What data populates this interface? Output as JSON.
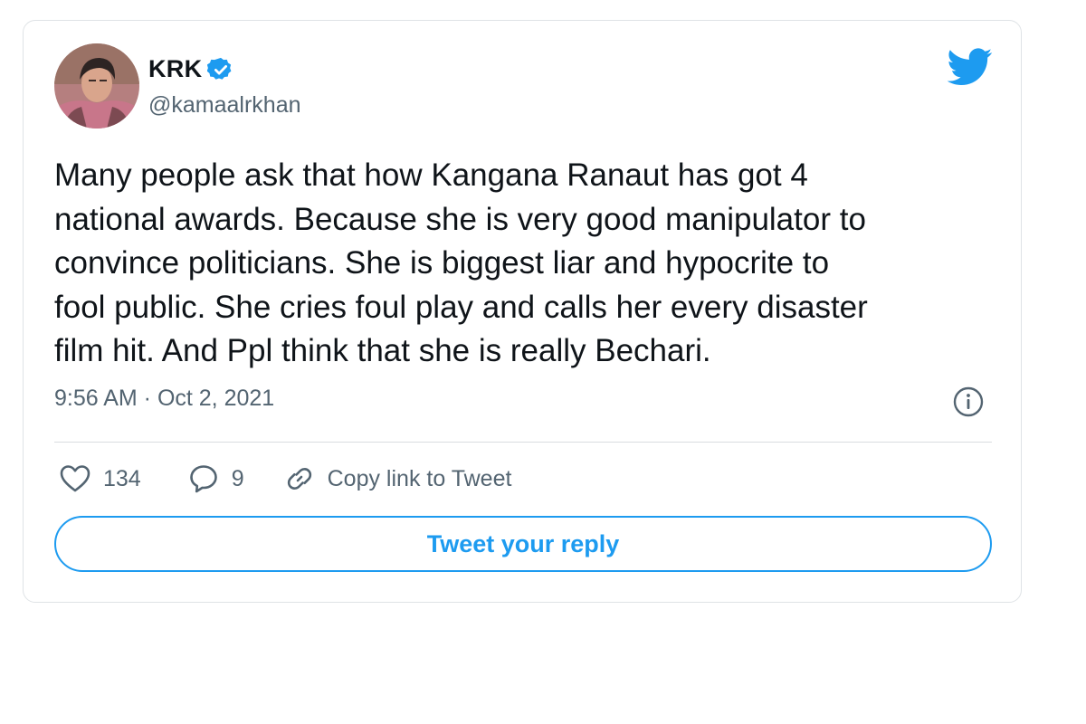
{
  "author": {
    "name": "KRK",
    "handle": "@kamaalrkhan",
    "verified": true
  },
  "tweet": {
    "text": "Many people ask that how Kangana Ranaut has got 4\nnational awards. Because she is very good manipulator to\nconvince politicians. She is biggest liar and hypocrite to\nfool public. She cries foul play and calls her every disaster\nfilm hit. And Ppl think that she is really Bechari.",
    "timestamp": "9:56 AM · Oct 2, 2021"
  },
  "actions": {
    "likes": "134",
    "replies": "9",
    "copy_link_label": "Copy link to Tweet"
  },
  "reply_button_label": "Tweet your reply",
  "icons": {
    "avatar": "avatar",
    "verified": "verified-badge-icon",
    "brand": "twitter-bird-icon",
    "info": "info-icon",
    "like": "heart-icon",
    "reply": "reply-bubble-icon",
    "link": "link-icon"
  },
  "colors": {
    "brand": "#1d9bf0",
    "text": "#0f1419",
    "muted": "#536471",
    "border": "#dfe3e6"
  }
}
